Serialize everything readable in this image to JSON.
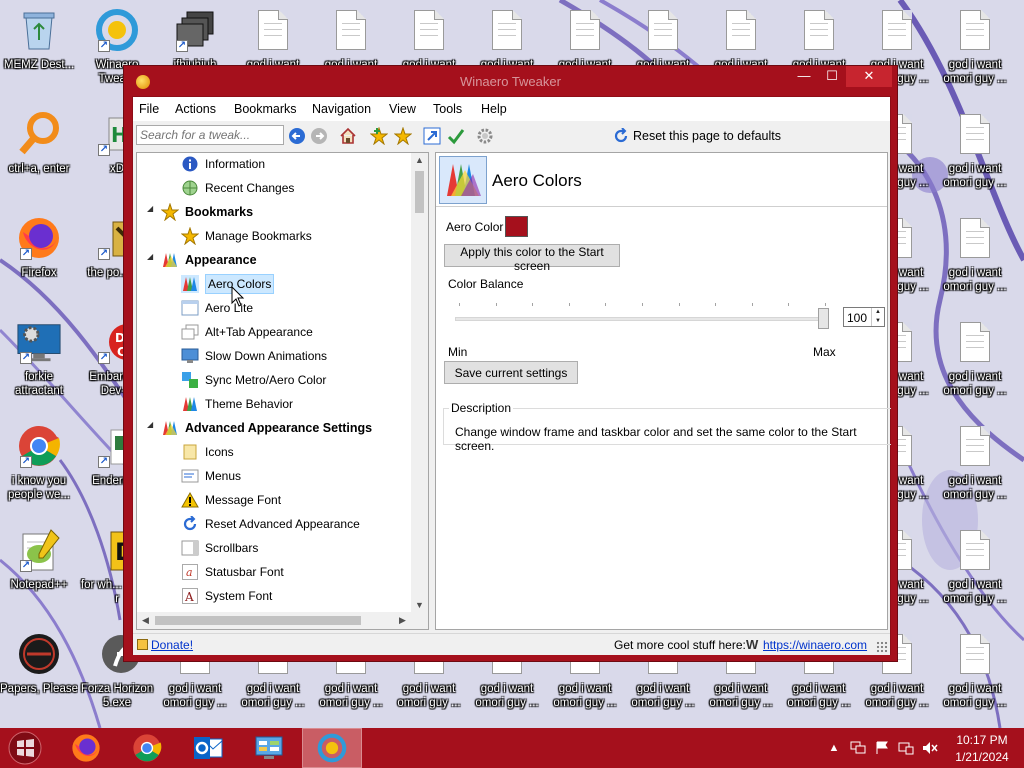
{
  "desktop": {
    "icons_left": [
      {
        "label": "MEMZ Dest...",
        "icon": "recycle-bin-icon"
      },
      {
        "label": "ctrl+a, enter",
        "icon": "magnifier-app-icon"
      },
      {
        "label": "Firefox",
        "icon": "firefox-icon"
      },
      {
        "label": "forkie attractant",
        "icon": "monitor-gear-icon"
      },
      {
        "label": "i know you people we...",
        "icon": "chrome-icon"
      },
      {
        "label": "Notepad++",
        "icon": "notepadpp-icon"
      },
      {
        "label": "Papers, Please",
        "icon": "papers-please-icon"
      }
    ],
    "icons_col2": [
      {
        "label": "Winaero Twea...",
        "icon": "winaero-icon"
      },
      {
        "label": "xD",
        "icon": "hex-editor-icon"
      },
      {
        "label": "the po... shi",
        "icon": "shortcut-app-icon"
      },
      {
        "label": "Embarca... Dev-C",
        "icon": "devcpp-icon"
      },
      {
        "label": "Enderm...",
        "icon": "enderman-icon"
      },
      {
        "label": "for wh... some r",
        "icon": "dollar-app-icon"
      },
      {
        "label": "Forza Horizon 5.exe",
        "icon": "flash-icon"
      }
    ],
    "doc_label": "god i want omori guy ...",
    "doc_label_short": "god i want",
    "doc_label_partial": "guy ...",
    "doc_label_want": "want",
    "third_col_label": "ifhiuhiuh"
  },
  "window": {
    "title": "Winaero Tweaker",
    "minimize": "—",
    "maximize": "☐",
    "close": "✕",
    "menu": [
      "File",
      "Actions",
      "Bookmarks",
      "Navigation",
      "View",
      "Tools",
      "Help"
    ],
    "search_placeholder": "Search for a tweak...",
    "reset_label": "Reset this page to defaults",
    "tree": [
      {
        "label": "Information",
        "level": 2,
        "icon": "info-icon"
      },
      {
        "label": "Recent Changes",
        "level": 2,
        "icon": "globe-icon"
      },
      {
        "label": "Bookmarks",
        "level": 1,
        "icon": "star-icon"
      },
      {
        "label": "Manage Bookmarks",
        "level": 2,
        "icon": "star-icon"
      },
      {
        "label": "Appearance",
        "level": 1,
        "icon": "palette-icon"
      },
      {
        "label": "Aero Colors",
        "level": 2,
        "icon": "palette-icon",
        "selected": true
      },
      {
        "label": "Aero Lite",
        "level": 2,
        "icon": "window-icon"
      },
      {
        "label": "Alt+Tab Appearance",
        "level": 2,
        "icon": "windows-stack-icon"
      },
      {
        "label": "Slow Down Animations",
        "level": 2,
        "icon": "monitor-icon"
      },
      {
        "label": "Sync Metro/Aero Color",
        "level": 2,
        "icon": "sync-color-icon"
      },
      {
        "label": "Theme Behavior",
        "level": 2,
        "icon": "palette-icon"
      },
      {
        "label": "Advanced Appearance Settings",
        "level": 1,
        "icon": "palette-icon"
      },
      {
        "label": "Icons",
        "level": 2,
        "icon": "folder-icon"
      },
      {
        "label": "Menus",
        "level": 2,
        "icon": "menu-icon"
      },
      {
        "label": "Message Font",
        "level": 2,
        "icon": "warning-icon"
      },
      {
        "label": "Reset Advanced Appearance",
        "level": 2,
        "icon": "reset-icon"
      },
      {
        "label": "Scrollbars",
        "level": 2,
        "icon": "scrollbar-icon"
      },
      {
        "label": "Statusbar Font",
        "level": 2,
        "icon": "font-a-icon"
      },
      {
        "label": "System Font",
        "level": 2,
        "icon": "font-A-icon"
      }
    ],
    "panel": {
      "title": "Aero Colors",
      "aero_color_label": "Aero Color",
      "aero_color": "#a5101c",
      "apply_button": "Apply this color to the Start screen",
      "balance_label": "Color Balance",
      "balance_value": "100",
      "balance_fraction": 1.0,
      "min_label": "Min",
      "max_label": "Max",
      "save_button": "Save current settings",
      "desc_legend": "Description",
      "desc_text": "Change window frame and taskbar color and set the same color to the Start screen."
    },
    "status": {
      "donate": "Donate!",
      "more_text": "Get more cool stuff here:",
      "logo": "W",
      "link": "https://winaero.com"
    }
  },
  "taskbar": {
    "time": "10:17 PM",
    "date": "1/21/2024",
    "apps": [
      "firefox-icon",
      "chrome-icon",
      "outlook-icon",
      "control-panel-icon",
      "winaero-icon"
    ]
  },
  "colors": {
    "accent": "#a5101c",
    "selection": "#cce8ff",
    "link": "#0033cc"
  }
}
